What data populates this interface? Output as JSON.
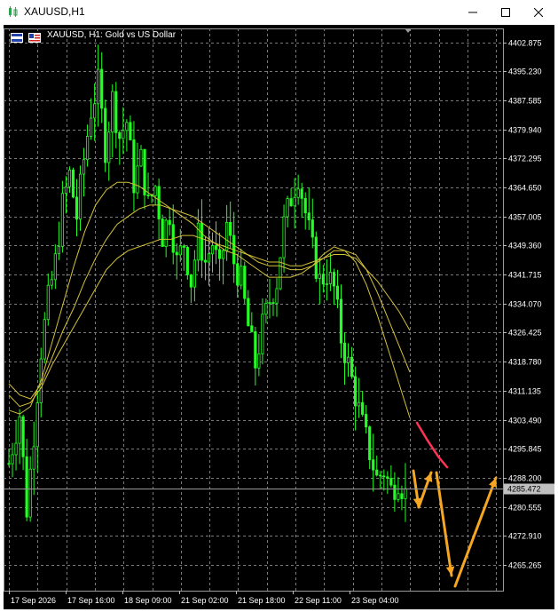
{
  "window": {
    "title": "XAUUSD,H1",
    "controls": [
      "minimize",
      "maximize",
      "close"
    ]
  },
  "chart_header": {
    "text": "XAUUSD, H1:  Gold vs US Dollar"
  },
  "chart_data": {
    "type": "candlestick",
    "symbol": "XAUUSD",
    "timeframe": "H1",
    "ylim": [
      4258.5,
      4406.5
    ],
    "y_ticks": [
      "4402.875",
      "4395.230",
      "4387.585",
      "4379.940",
      "4372.295",
      "4364.650",
      "4357.005",
      "4349.360",
      "4341.715",
      "4334.070",
      "4326.425",
      "4318.780",
      "4311.135",
      "4303.490",
      "4295.845",
      "4288.200",
      "4280.555",
      "4272.910",
      "4265.265"
    ],
    "x_ticks": [
      "17 Sep 2026",
      "17 Sep 16:00",
      "18 Sep 09:00",
      "21 Sep 02:00",
      "21 Sep 18:00",
      "22 Sep 11:00",
      "23 Sep 04:00"
    ],
    "current_price": "4285.472",
    "close_path": [
      [
        0,
        4292
      ],
      [
        3,
        4305
      ],
      [
        5,
        4280
      ],
      [
        7,
        4300
      ],
      [
        9,
        4322
      ],
      [
        11,
        4335
      ],
      [
        13,
        4345
      ],
      [
        15,
        4360
      ],
      [
        17,
        4368
      ],
      [
        19,
        4357
      ],
      [
        21,
        4372
      ],
      [
        23,
        4385
      ],
      [
        25,
        4392
      ],
      [
        27,
        4375
      ],
      [
        29,
        4388
      ],
      [
        31,
        4378
      ],
      [
        33,
        4382
      ],
      [
        35,
        4366
      ],
      [
        37,
        4372
      ],
      [
        39,
        4360
      ],
      [
        41,
        4365
      ],
      [
        43,
        4352
      ],
      [
        45,
        4358
      ],
      [
        47,
        4345
      ],
      [
        49,
        4350
      ],
      [
        51,
        4340
      ],
      [
        53,
        4352
      ],
      [
        55,
        4345
      ],
      [
        57,
        4350
      ],
      [
        59,
        4342
      ],
      [
        61,
        4355
      ],
      [
        63,
        4345
      ],
      [
        65,
        4340
      ],
      [
        67,
        4328
      ],
      [
        69,
        4318
      ],
      [
        71,
        4328
      ],
      [
        73,
        4335
      ],
      [
        75,
        4340
      ],
      [
        77,
        4355
      ],
      [
        79,
        4362
      ],
      [
        81,
        4368
      ],
      [
        83,
        4358
      ],
      [
        85,
        4348
      ],
      [
        87,
        4340
      ],
      [
        89,
        4342
      ],
      [
        91,
        4338
      ],
      [
        93,
        4325
      ],
      [
        95,
        4318
      ],
      [
        97,
        4310
      ],
      [
        99,
        4302
      ],
      [
        101,
        4295
      ],
      [
        103,
        4288
      ],
      [
        105,
        4290
      ],
      [
        107,
        4285
      ],
      [
        109,
        4288
      ],
      [
        111,
        4284
      ]
    ],
    "moving_averages": [
      {
        "values": [
          4310,
          4307,
          4308,
          4312,
          4318,
          4323,
          4328,
          4333,
          4338,
          4343,
          4346,
          4348,
          4349,
          4350,
          4351,
          4351,
          4352,
          4352,
          4351,
          4350,
          4349,
          4348,
          4347,
          4346,
          4345,
          4345,
          4344,
          4344,
          4345,
          4346,
          4347,
          4347,
          4346,
          4343,
          4340,
          4336,
          4332,
          4327
        ]
      },
      {
        "values": [
          4313,
          4310,
          4309,
          4313,
          4320,
          4327,
          4333,
          4340,
          4346,
          4351,
          4355,
          4357,
          4359,
          4360,
          4360,
          4359,
          4358,
          4357,
          4355,
          4353,
          4351,
          4349,
          4347,
          4345,
          4344,
          4344,
          4343,
          4343,
          4344,
          4346,
          4348,
          4348,
          4347,
          4343,
          4337,
          4330,
          4323,
          4316
        ]
      },
      {
        "values": [
          4306,
          4305,
          4307,
          4314,
          4324,
          4334,
          4344,
          4353,
          4360,
          4364,
          4366,
          4366,
          4365,
          4363,
          4361,
          4359,
          4357,
          4355,
          4352,
          4350,
          4348,
          4347,
          4345,
          4343,
          4341,
          4341,
          4341,
          4342,
          4344,
          4347,
          4349,
          4348,
          4345,
          4339,
          4331,
          4322,
          4313,
          4304
        ]
      }
    ],
    "ma_color": "#d4c23a",
    "candle_color": "#22ff22",
    "background": "#000000",
    "grid": true,
    "annotations": [
      {
        "type": "red-line",
        "color": "#ff3355",
        "points": [
          [
            4302,
            0
          ],
          [
            4297,
            1
          ],
          [
            4292,
            2
          ]
        ]
      },
      {
        "type": "orange-arrows",
        "color": "#f5a623"
      }
    ]
  },
  "colors": {
    "chart_bg": "#000000",
    "grid": "#7a7a7a",
    "candle": "#22ff22",
    "ma": "#d4c23a",
    "red_line": "#ff3355",
    "arrows": "#f5a623",
    "price_tag": "#c0c0c0"
  }
}
